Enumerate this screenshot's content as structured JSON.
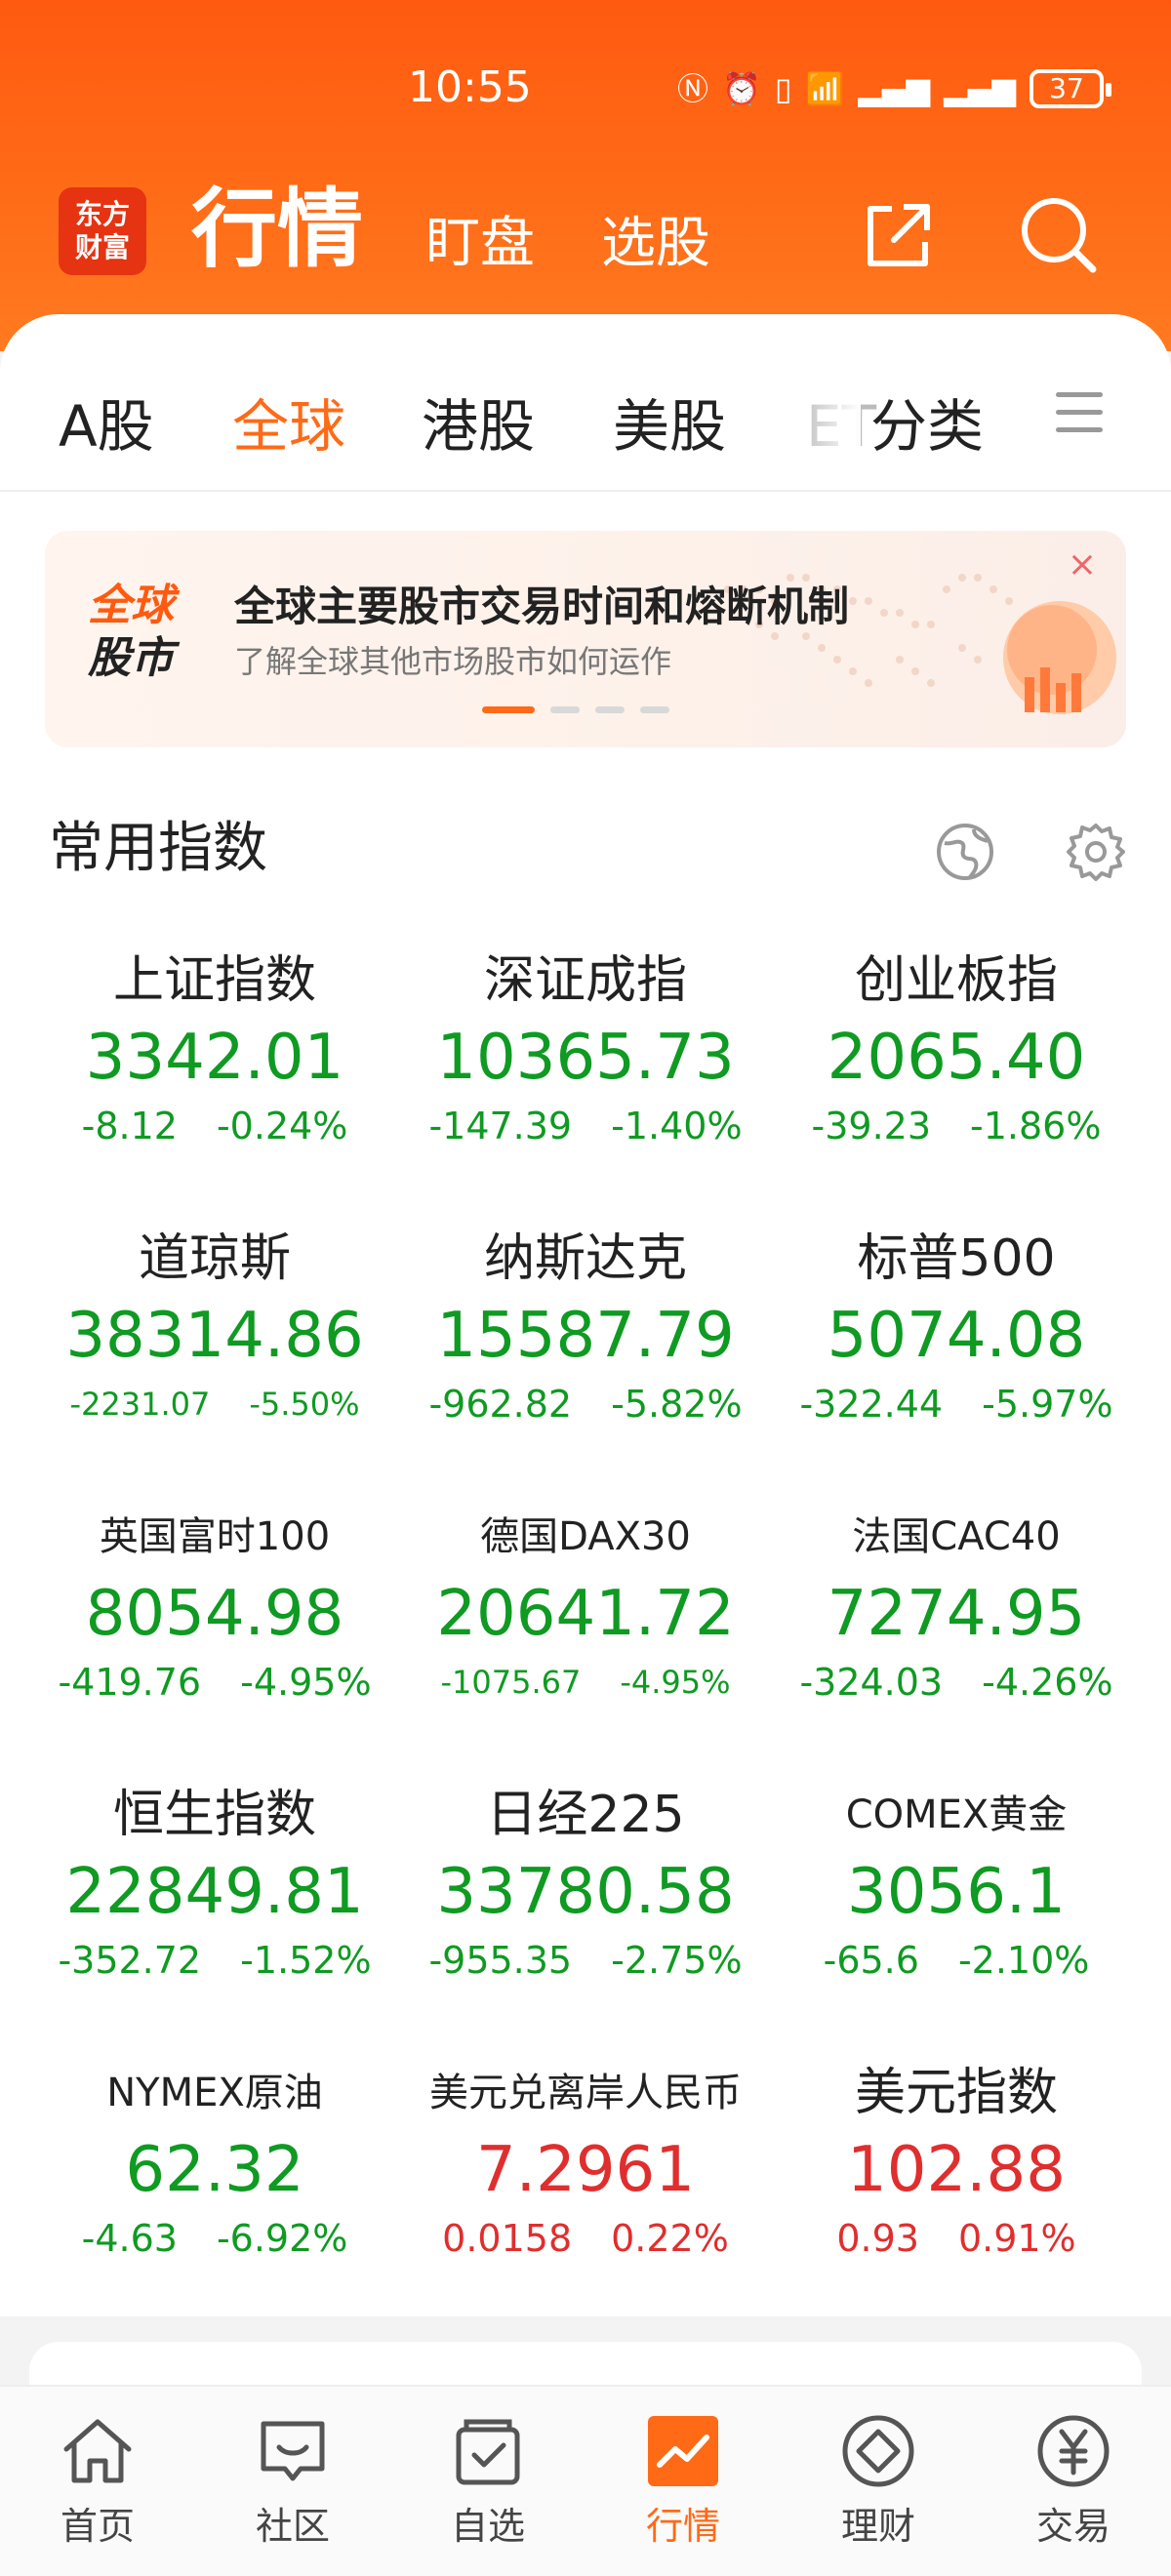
{
  "status_bar": {
    "time": "10:55",
    "battery": "37"
  },
  "header": {
    "logo_line1": "东方",
    "logo_line2": "财富",
    "title": "行情",
    "links": [
      "盯盘",
      "选股"
    ]
  },
  "tabs": [
    {
      "label": "A股",
      "active": false
    },
    {
      "label": "全球",
      "active": true
    },
    {
      "label": "港股",
      "active": false
    },
    {
      "label": "美股",
      "active": false
    },
    {
      "label": "ET",
      "active": false
    },
    {
      "label": "分类",
      "active": false
    }
  ],
  "banner": {
    "logo_top": "全球",
    "logo_bottom": "股市",
    "title": "全球主要股市交易时间和熔断机制",
    "subtitle": "了解全球其他市场股市如何运作",
    "close": "×",
    "page_count": 4,
    "active_page": 0
  },
  "section": {
    "title": "常用指数"
  },
  "indices": [
    {
      "name": "上证指数",
      "value": "3342.01",
      "change": "-8.12",
      "pct": "-0.24%",
      "dir": "down"
    },
    {
      "name": "深证成指",
      "value": "10365.73",
      "change": "-147.39",
      "pct": "-1.40%",
      "dir": "down"
    },
    {
      "name": "创业板指",
      "value": "2065.40",
      "change": "-39.23",
      "pct": "-1.86%",
      "dir": "down"
    },
    {
      "name": "道琼斯",
      "value": "38314.86",
      "change": "-2231.07",
      "pct": "-5.50%",
      "dir": "down"
    },
    {
      "name": "纳斯达克",
      "value": "15587.79",
      "change": "-962.82",
      "pct": "-5.82%",
      "dir": "down"
    },
    {
      "name": "标普500",
      "value": "5074.08",
      "change": "-322.44",
      "pct": "-5.97%",
      "dir": "down"
    },
    {
      "name": "英国富时100",
      "value": "8054.98",
      "change": "-419.76",
      "pct": "-4.95%",
      "dir": "down"
    },
    {
      "name": "德国DAX30",
      "value": "20641.72",
      "change": "-1075.67",
      "pct": "-4.95%",
      "dir": "down"
    },
    {
      "name": "法国CAC40",
      "value": "7274.95",
      "change": "-324.03",
      "pct": "-4.26%",
      "dir": "down"
    },
    {
      "name": "恒生指数",
      "value": "22849.81",
      "change": "-352.72",
      "pct": "-1.52%",
      "dir": "down"
    },
    {
      "name": "日经225",
      "value": "33780.58",
      "change": "-955.35",
      "pct": "-2.75%",
      "dir": "down"
    },
    {
      "name": "COMEX黄金",
      "value": "3056.1",
      "change": "-65.6",
      "pct": "-2.10%",
      "dir": "down"
    },
    {
      "name": "NYMEX原油",
      "value": "62.32",
      "change": "-4.63",
      "pct": "-6.92%",
      "dir": "down"
    },
    {
      "name": "美元兑离岸人民币",
      "value": "7.2961",
      "change": "0.0158",
      "pct": "0.22%",
      "dir": "up"
    },
    {
      "name": "美元指数",
      "value": "102.88",
      "change": "0.93",
      "pct": "0.91%",
      "dir": "up"
    }
  ],
  "bottom_nav": [
    {
      "label": "首页",
      "icon": "home-icon",
      "active": false
    },
    {
      "label": "社区",
      "icon": "community-icon",
      "active": false
    },
    {
      "label": "自选",
      "icon": "watchlist-icon",
      "active": false
    },
    {
      "label": "行情",
      "icon": "market-icon",
      "active": true
    },
    {
      "label": "理财",
      "icon": "wealth-icon",
      "active": false
    },
    {
      "label": "交易",
      "icon": "trade-icon",
      "active": false
    }
  ],
  "colors": {
    "accent": "#ff6a17",
    "down": "#0f9a22",
    "up": "#e02e2e"
  }
}
